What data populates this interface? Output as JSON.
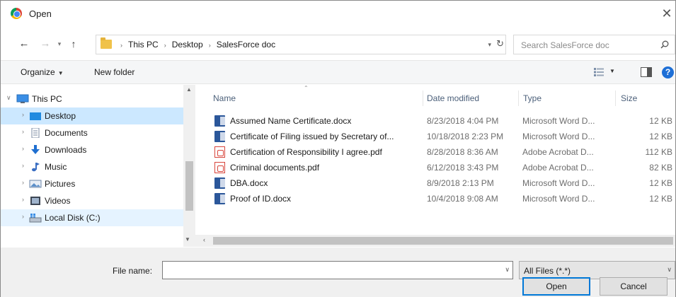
{
  "window": {
    "title": "Open",
    "close_glyph": "✕"
  },
  "nav": {
    "back_icon": "arrow-left-icon",
    "forward_icon": "arrow-right-icon",
    "recent_icon": "chevron-down-icon",
    "up_icon": "arrow-up-icon",
    "breadcrumbs": [
      "This PC",
      "Desktop",
      "SalesForce doc"
    ],
    "search_placeholder": "Search SalesForce doc"
  },
  "toolbar": {
    "organize_label": "Organize",
    "new_folder_label": "New folder",
    "help_label": "?"
  },
  "sidebar": {
    "items": [
      {
        "label": "This PC",
        "icon": "computer-icon",
        "expanded": true
      },
      {
        "label": "Desktop",
        "icon": "desktop-folder-icon",
        "selected": true
      },
      {
        "label": "Documents",
        "icon": "documents-icon"
      },
      {
        "label": "Downloads",
        "icon": "downloads-icon"
      },
      {
        "label": "Music",
        "icon": "music-icon"
      },
      {
        "label": "Pictures",
        "icon": "pictures-icon"
      },
      {
        "label": "Videos",
        "icon": "videos-icon"
      },
      {
        "label": "Local Disk (C:)",
        "icon": "local-disk-icon"
      }
    ]
  },
  "filelist": {
    "columns": {
      "name": "Name",
      "date": "Date modified",
      "type": "Type",
      "size": "Size"
    },
    "files": [
      {
        "name": "Assumed Name Certificate.docx",
        "date": "8/23/2018 4:04 PM",
        "type": "Microsoft Word D...",
        "size": "12 KB",
        "icon": "word-doc-icon"
      },
      {
        "name": "Certificate of Filing issued by Secretary of...",
        "date": "10/18/2018 2:23 PM",
        "type": "Microsoft Word D...",
        "size": "12 KB",
        "icon": "word-doc-icon"
      },
      {
        "name": "Certification of Responsibility I agree.pdf",
        "date": "8/28/2018 8:36 AM",
        "type": "Adobe Acrobat D...",
        "size": "112 KB",
        "icon": "pdf-icon"
      },
      {
        "name": "Criminal documents.pdf",
        "date": "6/12/2018 3:43 PM",
        "type": "Adobe Acrobat D...",
        "size": "82 KB",
        "icon": "pdf-icon"
      },
      {
        "name": "DBA.docx",
        "date": "8/9/2018 2:13 PM",
        "type": "Microsoft Word D...",
        "size": "12 KB",
        "icon": "word-doc-icon"
      },
      {
        "name": "Proof of ID.docx",
        "date": "10/4/2018 9:08 AM",
        "type": "Microsoft Word D...",
        "size": "12 KB",
        "icon": "word-doc-icon"
      }
    ]
  },
  "bottom": {
    "file_name_label": "File name:",
    "file_name_value": "",
    "file_type_value": "All Files (*.*)",
    "open_label": "Open",
    "cancel_label": "Cancel"
  },
  "colors": {
    "accent": "#0078d7",
    "selected": "#cce8ff",
    "column_header": "#4c607a"
  }
}
